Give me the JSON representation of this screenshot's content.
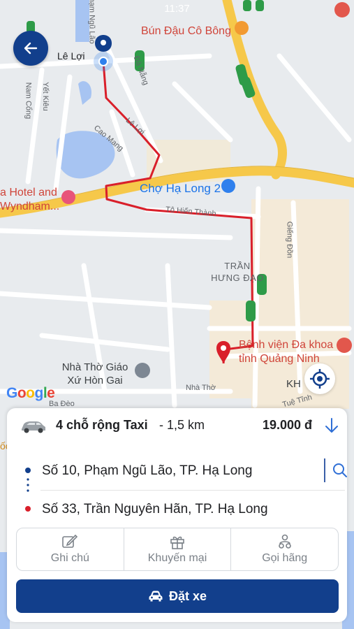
{
  "status_bar": {
    "time": "11:37"
  },
  "map": {
    "pois": [
      {
        "name": "Bún Đậu Cô Bông"
      },
      {
        "name": "a Hotel and Wyndham..."
      },
      {
        "name": "Chợ Hạ Long 2"
      },
      {
        "name": "Bệnh viện Đa khoa tỉnh Quảng Ninh"
      },
      {
        "name": "Nhà Thờ Giáo Xứ Hòn Gai"
      }
    ],
    "streets": [
      "Lê Lợi",
      "Lê Lợi",
      "Phạm Ngũ Lão",
      "Đà Nẵng",
      "Yết Kiêu",
      "Nam Cổng",
      "Cao Mang",
      "Tô Hiến Thành",
      "Giếng Đồn",
      "Nhà Thờ",
      "Ba Đèo",
      "Tuệ Tĩnh",
      "ốc bàng"
    ],
    "area": "TRẦN HƯNG ĐẠO",
    "kh_label": "KH",
    "google": "Google"
  },
  "trip": {
    "service_name": "4 chỗ rộng Taxi",
    "distance": "- 1,5 km",
    "price": "19.000 đ",
    "pickup": "Số 10, Phạm Ngũ Lão, TP. Hạ Long",
    "dropoff": "Số 33, Trần Nguyên Hãn, TP. Hạ Long"
  },
  "actions": {
    "note": "Ghi chú",
    "promo": "Khuyến mại",
    "call_company": "Gọi hãng"
  },
  "book_label": "Đặt xe",
  "colors": {
    "primary": "#123f8c",
    "route": "#d91f2a",
    "pickup_dot": "#123f8c",
    "dropoff_dot": "#d91f2a",
    "map_bg": "#e9ecef",
    "major_road": "#f6c84a",
    "water": "#a7c4f2"
  },
  "icons": {
    "back": "arrow-left-icon",
    "locate": "crosshair-icon",
    "car": "car-icon",
    "search": "search-icon",
    "note": "pencil-icon",
    "promo": "gift-icon",
    "call": "people-icon",
    "book": "car-front-icon"
  }
}
